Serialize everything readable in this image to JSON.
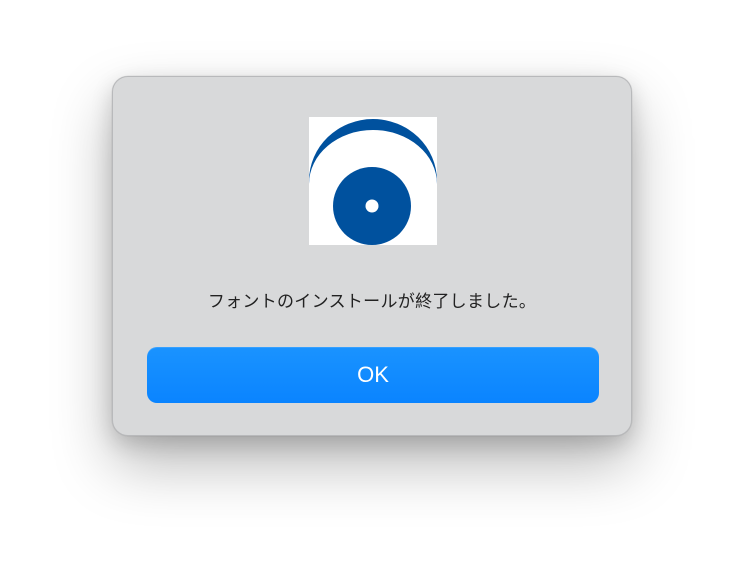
{
  "dialog": {
    "icon": "font-installer-eye-icon",
    "message": "フォントのインストールが終了しました。",
    "ok_label": "OK"
  },
  "colors": {
    "accent": "#0a84ff",
    "icon_blue": "#00519e",
    "dialog_bg": "#d8d9da"
  }
}
